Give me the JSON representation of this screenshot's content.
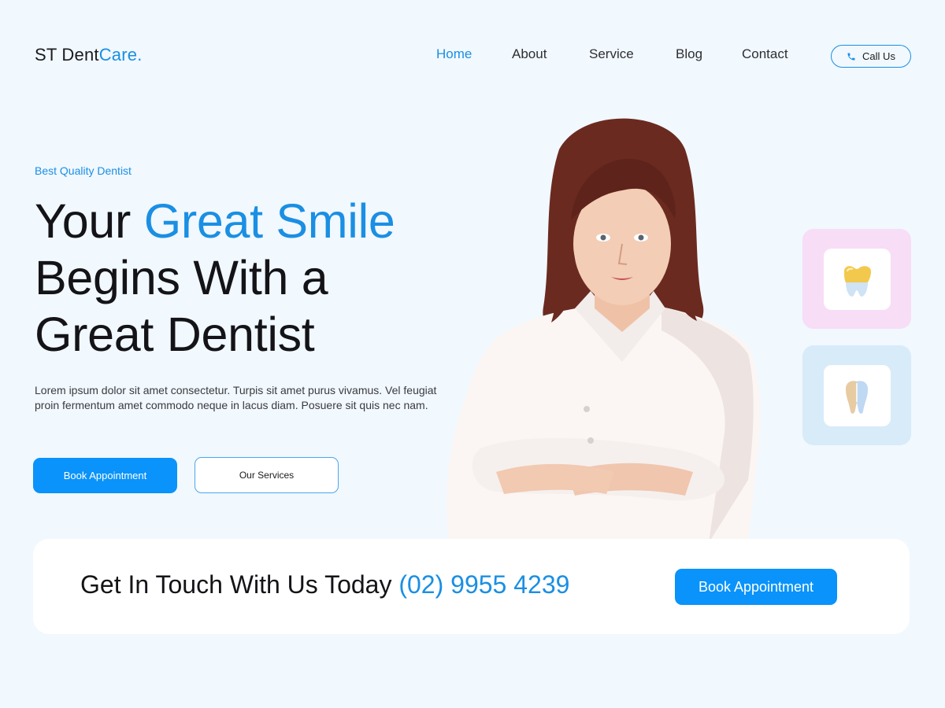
{
  "brand": {
    "name_main": "ST Dent",
    "name_accent": "Care."
  },
  "nav": {
    "items": [
      {
        "label": "Home",
        "active": true
      },
      {
        "label": "About",
        "active": false
      },
      {
        "label": "Service",
        "active": false
      },
      {
        "label": "Blog",
        "active": false
      },
      {
        "label": "Contact",
        "active": false
      }
    ],
    "call_label": "Call Us"
  },
  "hero": {
    "eyebrow": "Best Quality Dentist",
    "headline_lead": "Your ",
    "headline_accent": "Great Smile",
    "headline_line2": "Begins With a",
    "headline_line3": "Great Dentist",
    "description": "Lorem ipsum dolor sit amet consectetur. Turpis sit amet purus vivamus. Vel feugiat proin fermentum amet commodo neque in lacus diam. Posuere sit quis nec nam.",
    "primary_button": "Book Appointment",
    "secondary_button": "Our Services"
  },
  "side_cards": [
    {
      "icon": "gold-crown-tooth-icon",
      "background": "#F7DDF6"
    },
    {
      "icon": "tooth-implant-icon",
      "background": "#D8EBF9"
    }
  ],
  "cta": {
    "text": "Get In Touch With Us Today ",
    "phone": "(02) 9955 4239",
    "button": "Book Appointment"
  },
  "colors": {
    "accent": "#1A8FE3",
    "button": "#0A93FA",
    "background": "#F1F8FE"
  }
}
